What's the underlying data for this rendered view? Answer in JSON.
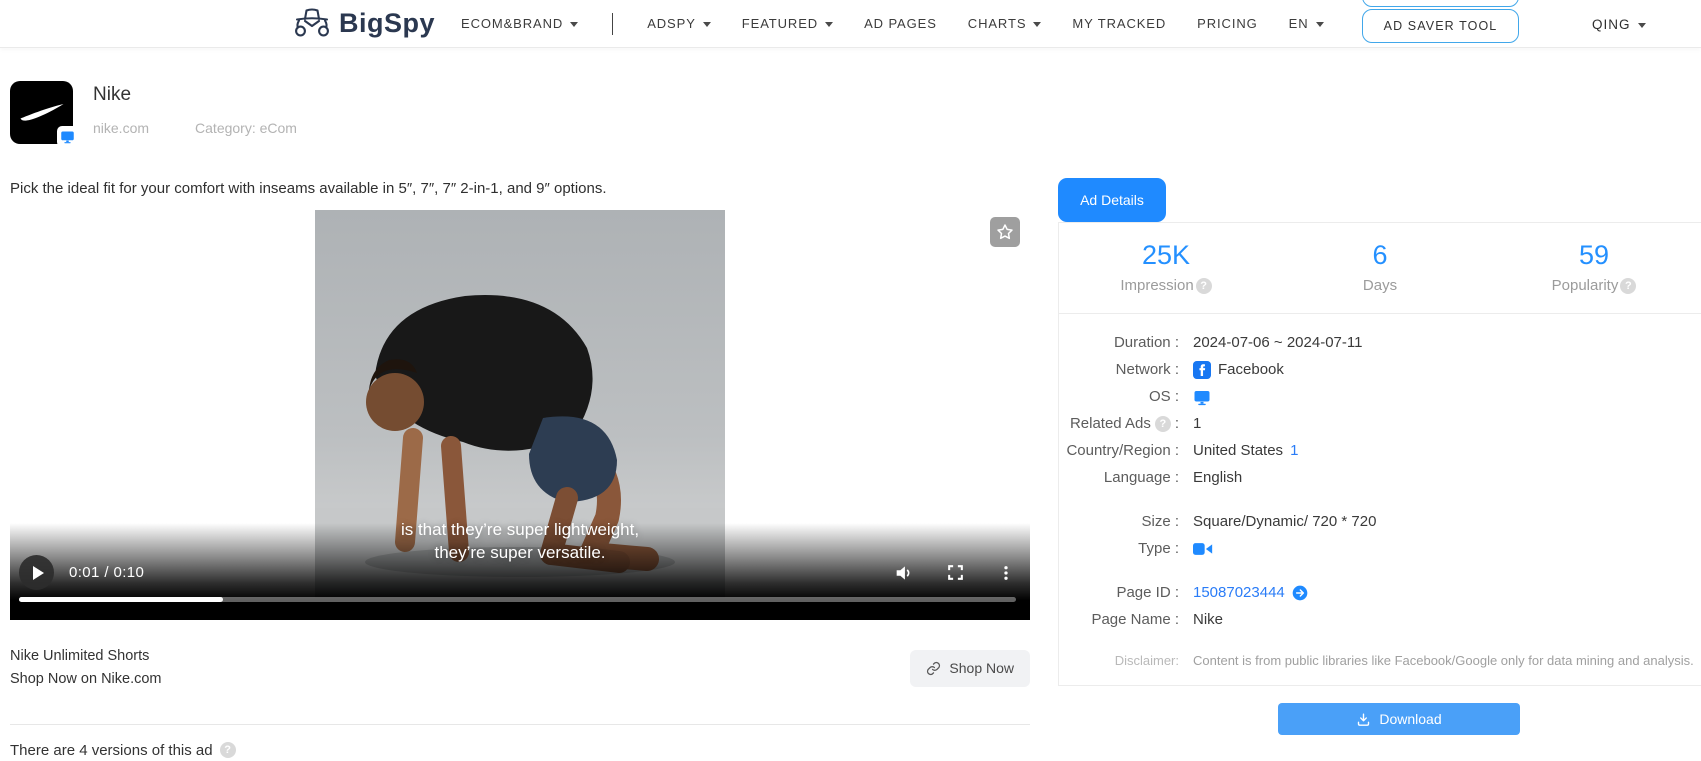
{
  "nav": {
    "brand": "BigSpy",
    "items": [
      {
        "label": "ECOM&BRAND"
      },
      {
        "label": "ADSPY"
      },
      {
        "label": "FEATURED"
      },
      {
        "label": "AD PAGES"
      },
      {
        "label": "CHARTS"
      },
      {
        "label": "MY TRACKED"
      },
      {
        "label": "PRICING"
      },
      {
        "label": "EN"
      }
    ],
    "ad_saver_label": "AD SAVER TOOL",
    "user_label": "QING"
  },
  "advertiser": {
    "name": "Nike",
    "domain": "nike.com",
    "category": "Category: eCom"
  },
  "ad": {
    "body_text": "Pick the ideal fit for your comfort with inseams available in 5″, 7″, 7″ 2-in-1, and 9″ options.",
    "video": {
      "caption_line1": "is that they’re super lightweight,",
      "caption_line2": "they’re super versatile.",
      "time": "0:01 / 0:10",
      "progress_percent": 20.5
    },
    "title": "Nike Unlimited Shorts",
    "link_text": "Shop Now on Nike.com",
    "cta_label": "Shop Now",
    "versions_note": "There are 4 versions of this ad"
  },
  "panel": {
    "tab_label": "Ad Details",
    "stats": [
      {
        "value": "25K",
        "label": "Impression",
        "help": true
      },
      {
        "value": "6",
        "label": "Days",
        "help": false
      },
      {
        "value": "59",
        "label": "Popularity",
        "help": true
      }
    ],
    "rows": {
      "duration_label": "Duration :",
      "duration_value": "2024-07-06 ~ 2024-07-11",
      "network_label": "Network :",
      "network_value": "Facebook",
      "os_label": "OS :",
      "related_label": "Related Ads",
      "related_colon": ":",
      "related_value": "1",
      "country_label": "Country/Region :",
      "country_value": "United States",
      "country_link": "1",
      "language_label": "Language :",
      "language_value": "English",
      "size_label": "Size :",
      "size_value": "Square/Dynamic/ 720 * 720",
      "type_label": "Type :",
      "pageid_label": "Page ID :",
      "pageid_value": "15087023444",
      "pagename_label": "Page Name :",
      "pagename_value": "Nike"
    },
    "disclaimer_label": "Disclaimer:",
    "disclaimer_text": "Content is from public libraries like Facebook/Google only for data mining and analysis.",
    "download_label": "Download"
  },
  "icons": {
    "brand": "spy-hat-icon",
    "favorite": "star-icon",
    "network": "facebook-icon",
    "os": "desktop-monitor-icon",
    "type": "video-camera-icon",
    "page_id": "arrow-right-circle-icon",
    "cta": "link-icon",
    "download": "download-icon",
    "help": "question-mark-icon"
  },
  "colors": {
    "accent_blue": "#1f8aff",
    "stat_blue": "#2490ff",
    "download_blue": "#4aa0f8",
    "link_blue": "#2a7cf7",
    "outline_blue": "#41a7ea",
    "facebook_blue": "#1877f2"
  }
}
